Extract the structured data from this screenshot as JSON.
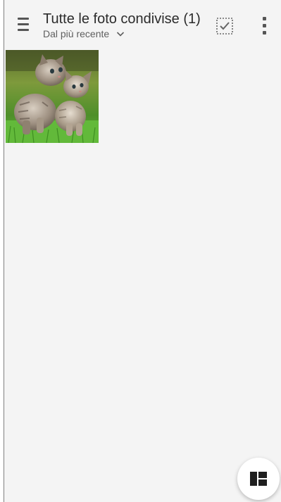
{
  "header": {
    "title": "Tutte le foto condivise (1)",
    "sort_label": "Dal più recente"
  },
  "icons": {
    "menu": "menu-icon",
    "sort_chevron": "chevron-down-icon",
    "select": "select-all-icon",
    "more": "more-vert-icon",
    "fab": "layout-icon"
  },
  "gallery": {
    "items": [
      {
        "subject": "two tabby kittens on grass"
      }
    ]
  },
  "colors": {
    "background": "#f4f4f4",
    "text_primary": "#2b2b2b",
    "text_secondary": "#5f5f5f",
    "icon": "#555555",
    "fab_icon": "#1f1f1f"
  }
}
